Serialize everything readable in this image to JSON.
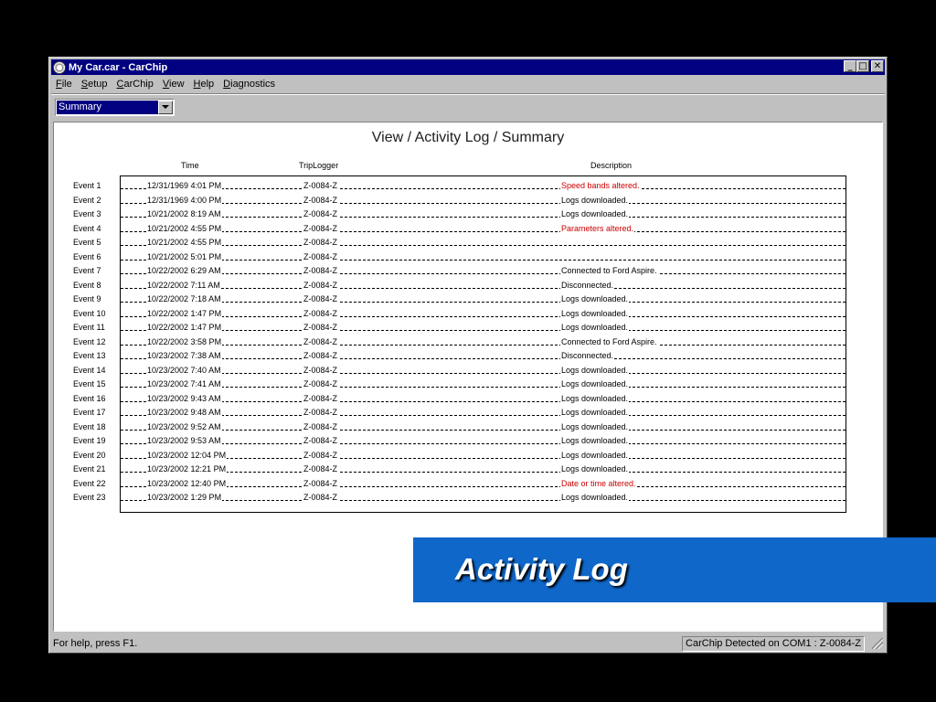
{
  "window": {
    "title": "My Car.car - CarChip",
    "controls": [
      "_",
      "□",
      "✕"
    ]
  },
  "menu": [
    {
      "label": "File",
      "accel": "F",
      "rest": "ile"
    },
    {
      "label": "Setup",
      "accel": "S",
      "rest": "etup"
    },
    {
      "label": "CarChip",
      "accel": "C",
      "rest": "arChip"
    },
    {
      "label": "View",
      "accel": "V",
      "rest": "iew"
    },
    {
      "label": "Help",
      "accel": "H",
      "rest": "elp"
    },
    {
      "label": "Diagnostics",
      "accel": "D",
      "rest": "iagnostics"
    }
  ],
  "view_select": {
    "value": "Summary"
  },
  "report": {
    "title": "View / Activity Log / Summary",
    "columns": {
      "time": "Time",
      "triplogger": "TripLogger",
      "description": "Description"
    },
    "events": [
      {
        "label": "Event 1",
        "time": "12/31/1969 4:01 PM",
        "logger": "Z-0084-Z",
        "desc": "Speed bands altered.",
        "alert": true
      },
      {
        "label": "Event 2",
        "time": "12/31/1969 4:00 PM",
        "logger": "Z-0084-Z",
        "desc": "Logs downloaded.",
        "alert": false
      },
      {
        "label": "Event 3",
        "time": "10/21/2002 8:19 AM",
        "logger": "Z-0084-Z",
        "desc": "Logs downloaded.",
        "alert": false
      },
      {
        "label": "Event 4",
        "time": "10/21/2002 4:55 PM",
        "logger": "Z-0084-Z",
        "desc": "Parameters altered.",
        "alert": true
      },
      {
        "label": "Event 5",
        "time": "10/21/2002 4:55 PM",
        "logger": "Z-0084-Z",
        "desc": "",
        "alert": false
      },
      {
        "label": "Event 6",
        "time": "10/21/2002 5:01 PM",
        "logger": "Z-0084-Z",
        "desc": "",
        "alert": false
      },
      {
        "label": "Event 7",
        "time": "10/22/2002 6:29 AM",
        "logger": "Z-0084-Z",
        "desc": "Connected to Ford Aspire.",
        "alert": false
      },
      {
        "label": "Event 8",
        "time": "10/22/2002 7:11 AM",
        "logger": "Z-0084-Z",
        "desc": "Disconnected.",
        "alert": false
      },
      {
        "label": "Event 9",
        "time": "10/22/2002 7:18 AM",
        "logger": "Z-0084-Z",
        "desc": "Logs downloaded.",
        "alert": false
      },
      {
        "label": "Event 10",
        "time": "10/22/2002 1:47 PM",
        "logger": "Z-0084-Z",
        "desc": "Logs downloaded.",
        "alert": false
      },
      {
        "label": "Event 11",
        "time": "10/22/2002 1:47 PM",
        "logger": "Z-0084-Z",
        "desc": "Logs downloaded.",
        "alert": false
      },
      {
        "label": "Event 12",
        "time": "10/22/2002 3:58 PM",
        "logger": "Z-0084-Z",
        "desc": "Connected to Ford Aspire.",
        "alert": false
      },
      {
        "label": "Event 13",
        "time": "10/23/2002 7:38 AM",
        "logger": "Z-0084-Z",
        "desc": "Disconnected.",
        "alert": false
      },
      {
        "label": "Event 14",
        "time": "10/23/2002 7:40 AM",
        "logger": "Z-0084-Z",
        "desc": "Logs downloaded.",
        "alert": false
      },
      {
        "label": "Event 15",
        "time": "10/23/2002 7:41 AM",
        "logger": "Z-0084-Z",
        "desc": "Logs downloaded.",
        "alert": false
      },
      {
        "label": "Event 16",
        "time": "10/23/2002 9:43 AM",
        "logger": "Z-0084-Z",
        "desc": "Logs downloaded.",
        "alert": false
      },
      {
        "label": "Event 17",
        "time": "10/23/2002 9:48 AM",
        "logger": "Z-0084-Z",
        "desc": "Logs downloaded.",
        "alert": false
      },
      {
        "label": "Event 18",
        "time": "10/23/2002 9:52 AM",
        "logger": "Z-0084-Z",
        "desc": "Logs downloaded.",
        "alert": false
      },
      {
        "label": "Event 19",
        "time": "10/23/2002 9:53 AM",
        "logger": "Z-0084-Z",
        "desc": "Logs downloaded.",
        "alert": false
      },
      {
        "label": "Event 20",
        "time": "10/23/2002 12:04 PM",
        "logger": "Z-0084-Z",
        "desc": "Logs downloaded.",
        "alert": false
      },
      {
        "label": "Event 21",
        "time": "10/23/2002 12:21 PM",
        "logger": "Z-0084-Z",
        "desc": "Logs downloaded.",
        "alert": false
      },
      {
        "label": "Event 22",
        "time": "10/23/2002 12:40 PM",
        "logger": "Z-0084-Z",
        "desc": "Date or time altered.",
        "alert": true
      },
      {
        "label": "Event 23",
        "time": "10/23/2002 1:29 PM",
        "logger": "Z-0084-Z",
        "desc": "Logs downloaded.",
        "alert": false
      }
    ]
  },
  "status": {
    "help": "For help, press F1.",
    "device": "CarChip Detected on COM1 : Z-0084-Z"
  },
  "banner": {
    "text": "Activity Log"
  },
  "colors": {
    "titlebar": "#000080",
    "alert_text": "#cc0000",
    "banner": "#0f67c9"
  }
}
